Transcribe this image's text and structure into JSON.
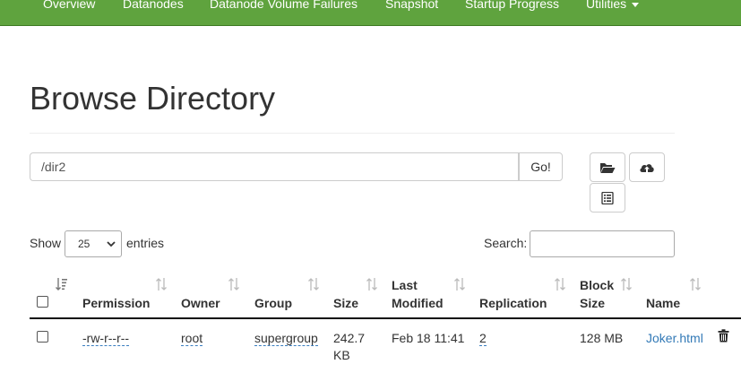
{
  "nav": {
    "items": [
      "Overview",
      "Datanodes",
      "Datanode Volume Failures",
      "Snapshot",
      "Startup Progress",
      "Utilities"
    ]
  },
  "page": {
    "title": "Browse Directory"
  },
  "path_bar": {
    "value": "/dir2",
    "go_label": "Go!"
  },
  "toolbar": {
    "icons": [
      "open-folder-icon",
      "cloud-upload-icon",
      "list-icon"
    ]
  },
  "controls": {
    "show_label": "Show",
    "entries_value": "25",
    "entries_label": "entries",
    "search_label": "Search:"
  },
  "table": {
    "headers": {
      "permission": "Permission",
      "owner": "Owner",
      "group": "Group",
      "size": "Size",
      "last_modified_1": "Last",
      "last_modified_2": "Modified",
      "replication": "Replication",
      "block_size_1": "Block",
      "block_size_2": "Size",
      "name": "Name"
    },
    "rows": [
      {
        "permission": "-rw-r--r--",
        "owner": "root",
        "group": "supergroup",
        "size_1": "242.7",
        "size_2": "KB",
        "last_modified": "Feb 18 11:41",
        "replication": "2",
        "block_size": "128 MB",
        "name": "Joker.html"
      }
    ]
  },
  "colors": {
    "navbar": "#5fa33e",
    "link": "#337ab7",
    "text": "#333333"
  }
}
